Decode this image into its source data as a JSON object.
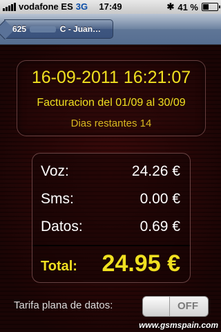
{
  "status_bar": {
    "carrier": "vodafone ES",
    "network": "3G",
    "time": "17:49",
    "battery": "41 %",
    "battery_level": 0.41
  },
  "nav": {
    "back_prefix": "625",
    "back_suffix": "C - Juan…"
  },
  "summary": {
    "datetime": "16-09-2011 16:21:07",
    "period": "Facturacion del 01/09 al 30/09",
    "remaining": "Dias restantes 14"
  },
  "usage": {
    "rows": [
      {
        "label": "Voz:",
        "value": "24.26 €"
      },
      {
        "label": "Sms:",
        "value": "0.00 €"
      },
      {
        "label": "Datos:",
        "value": "0.69 €"
      }
    ],
    "total_label": "Total:",
    "total_value": "24.95 €"
  },
  "flat_rate": {
    "label": "Tarifa plana de datos:",
    "state": "OFF"
  },
  "watermark": "www.gsmspain.com",
  "colors": {
    "accent_yellow": "#f0e020",
    "background": "#2a0606",
    "nav_blue": "#566e91"
  }
}
